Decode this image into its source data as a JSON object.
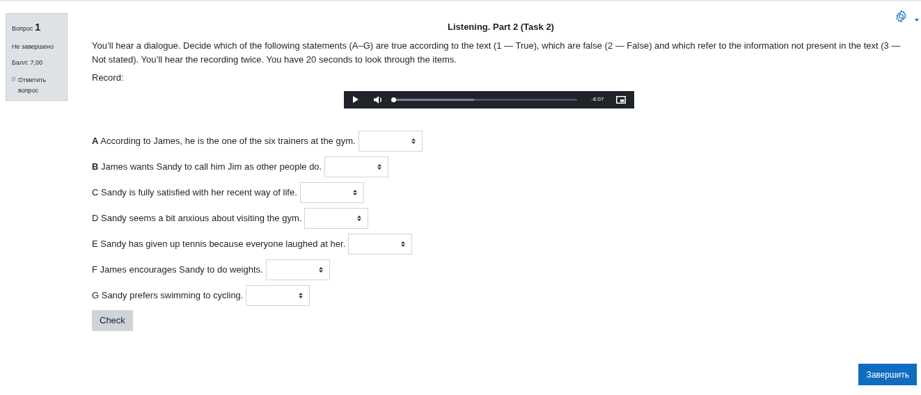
{
  "question_info": {
    "label": "Вопрос",
    "number": "1",
    "state": "Не завершено",
    "grade": "Балл: 7,00",
    "flag": "Отметить вопрос",
    "flagged": false
  },
  "title": "Listening. Part 2 (Task 2)",
  "instructions": "You’ll hear a dialogue. Decide which of the following statements (A–G) are true according to the text (1 — True), which are false (2 — False) and which refer to the information not present in the text (3 — Not stated). You’ll hear the recording twice. You have 20 seconds to look through the items.",
  "record_label": "Record:",
  "player": {
    "time": "-6:07",
    "level": 0.44,
    "playing": false
  },
  "statements": [
    {
      "text": "**A** According to James, he is the one of the six trainers at the gym."
    },
    {
      "text": "**B** James wants Sandy to call him Jim as other people do."
    },
    {
      "text": "C Sandy is fully satisfied with her recent way of life."
    },
    {
      "text": "D Sandy seems a bit anxious about visiting the gym."
    },
    {
      "text": "E Sandy has given up tennis because everyone laughed at her."
    },
    {
      "text": "F James encourages Sandy to do weights."
    },
    {
      "text": "G Sandy prefers swimming to cycling."
    }
  ],
  "check_button": "Check",
  "finish_button": "Завершить"
}
